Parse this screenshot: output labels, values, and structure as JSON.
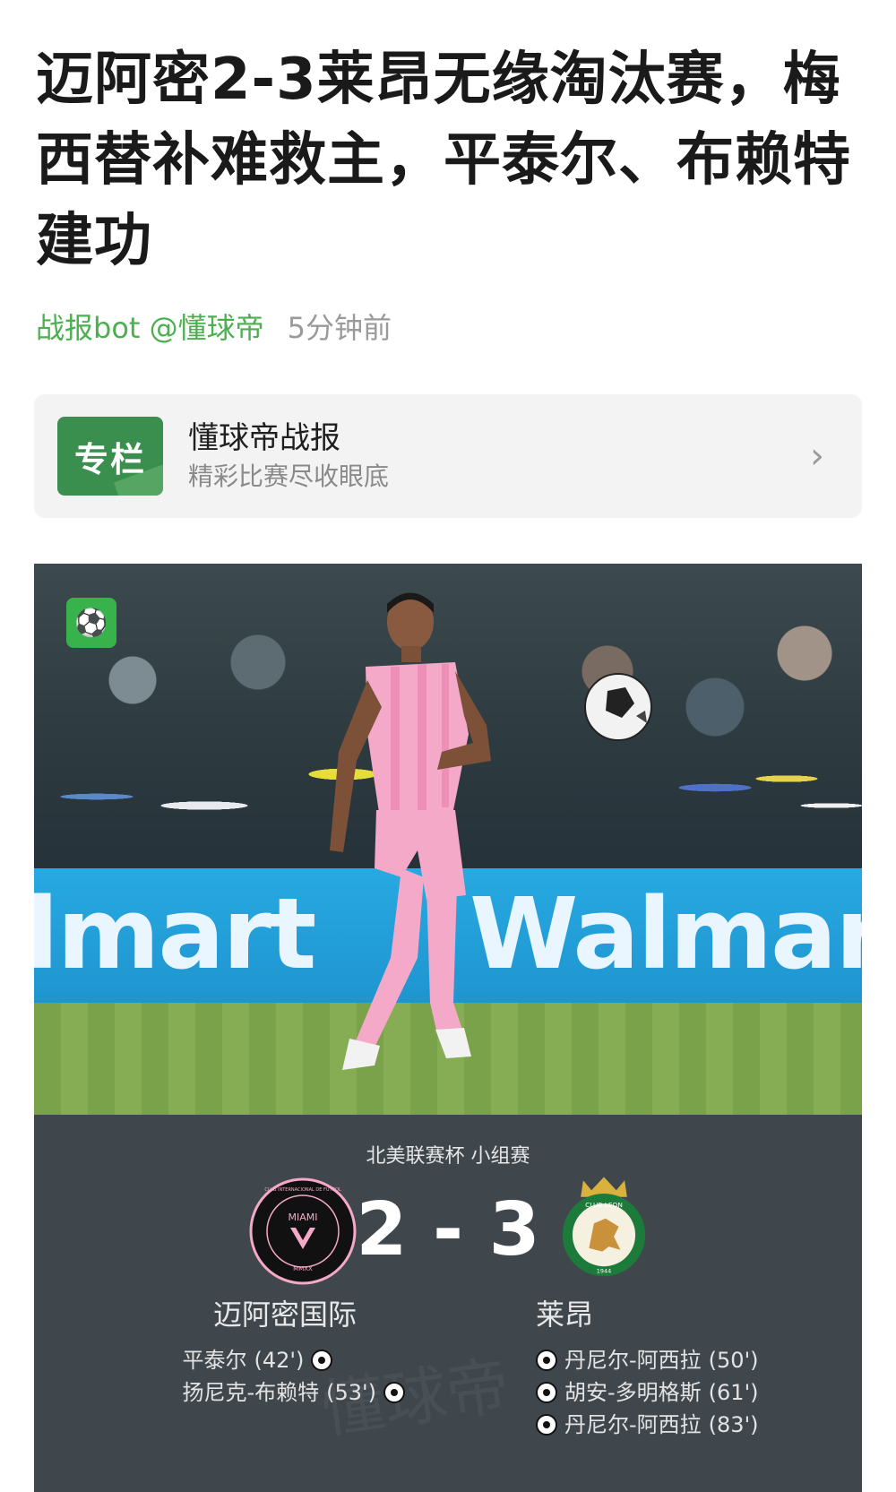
{
  "article": {
    "title": "迈阿密2-3莱昂无缘淘汰赛，梅西替补难救主，平泰尔、布赖特建功",
    "author": "战报bot @懂球帝",
    "time": "5分钟前"
  },
  "column_card": {
    "logo_text": "专栏",
    "title": "懂球帝战报",
    "subtitle": "精彩比赛尽收眼底"
  },
  "photo": {
    "banner_left": "lmart",
    "banner_right": "Walmart"
  },
  "match": {
    "competition": "北美联赛杯 小组赛",
    "home_score": "2",
    "away_score": "3",
    "home_team": "迈阿密国际",
    "away_team": "莱昂",
    "home_logo_top": "CLUB INTERNACIONAL DE FUTBOL",
    "home_logo_mid": "MIAMI",
    "home_logo_bottom": "MMXX",
    "away_logo_text": "CLUB LEON",
    "away_logo_year": "1944",
    "watermark": "懂球帝",
    "home_scorers": [
      {
        "name": "平泰尔",
        "minute": "(42')"
      },
      {
        "name": "扬尼克-布赖特",
        "minute": "(53')"
      }
    ],
    "away_scorers": [
      {
        "name": "丹尼尔-阿西拉",
        "minute": "(50')"
      },
      {
        "name": "胡安-多明格斯",
        "minute": "(61')"
      },
      {
        "name": "丹尼尔-阿西拉",
        "minute": "(83')"
      }
    ]
  },
  "colors": {
    "author_green": "#4caf50",
    "panel_bg": "#3f474d",
    "miami_pink": "#f4a9c8"
  }
}
